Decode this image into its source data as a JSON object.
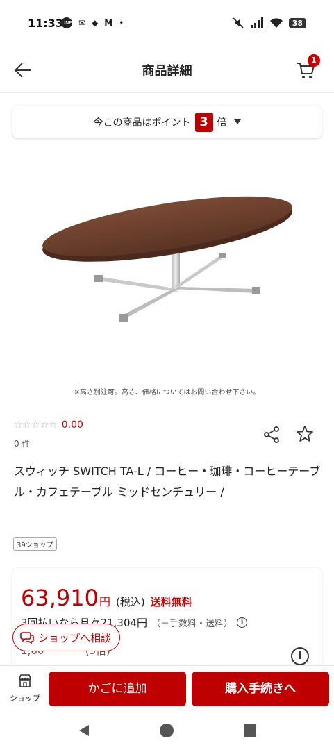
{
  "status_bar": {
    "time": "11:33",
    "left_icons": [
      "LINE",
      "✉",
      "◆",
      "M",
      "•"
    ],
    "battery": "38"
  },
  "header": {
    "title": "商品詳細",
    "cart_count": "1"
  },
  "points_banner": {
    "prefix": "今この商品はポイント",
    "multiplier": "3",
    "suffix": "倍"
  },
  "product": {
    "image_note": "※高さ別注可。高さ、価格についてはお問い合わせ下さい。",
    "rating_stars": "☆☆☆☆☆",
    "rating_value": "0.00",
    "review_count": "0 件",
    "title": "スウィッチ SWITCH TA-L / コーヒー・珈琲・コーヒーテーブル・カフェテーブル ミッドセンチュリー /",
    "shop_tag": "39ショップ"
  },
  "price": {
    "amount": "63,910",
    "yen": "円",
    "tax": "(税込)",
    "shipping": "送料無料",
    "installment": "3回払いなら月々21,304円",
    "installment_fee": "（＋手数料・送料）",
    "partial_row": "1,60　 　 　 (3倍)"
  },
  "consult": {
    "label": "ショップへ相談"
  },
  "bottom_bar": {
    "shop_label": "ショップ",
    "add_to_cart": "かごに追加",
    "checkout": "購入手続きへ"
  },
  "colors": {
    "accent": "#bf0000"
  }
}
